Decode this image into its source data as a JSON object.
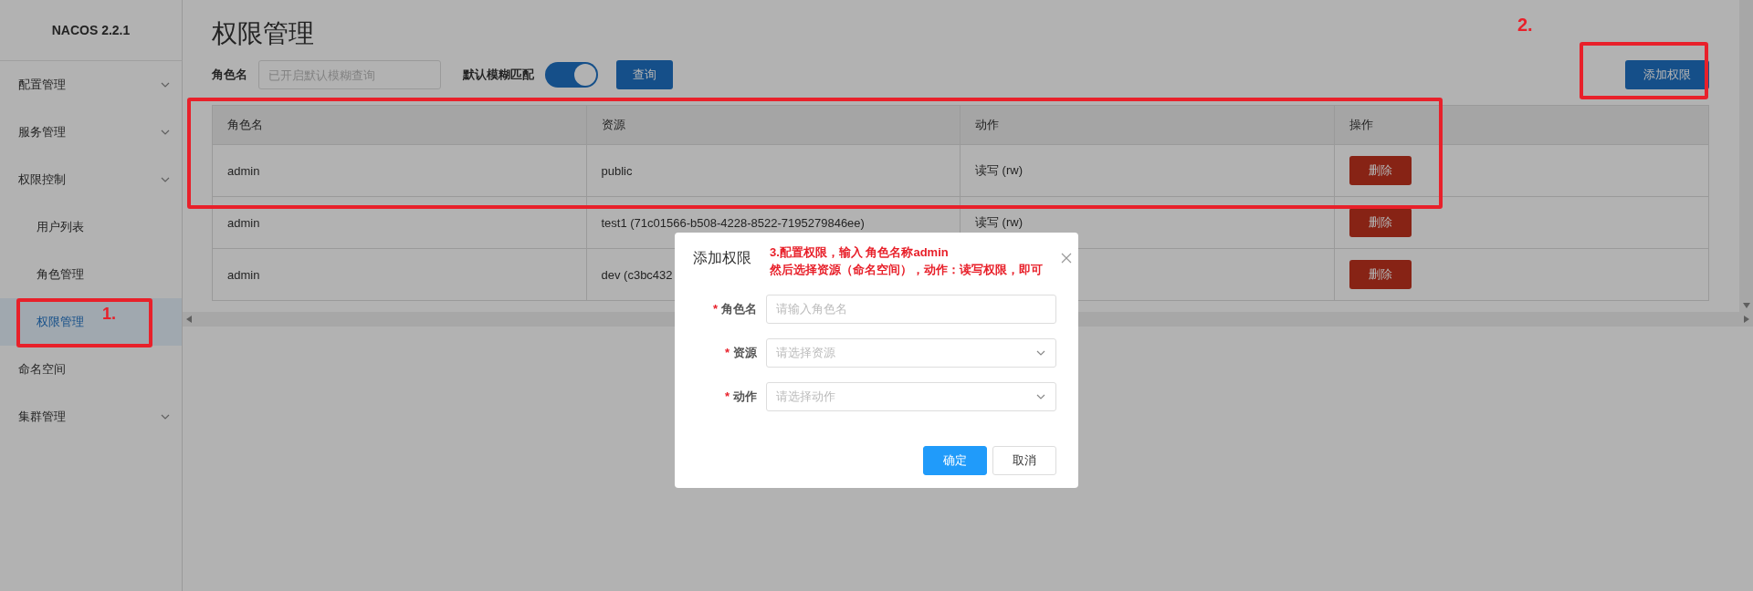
{
  "sidebar": {
    "logo": "NACOS 2.2.1",
    "items": [
      {
        "kind": "group",
        "label": "配置管理",
        "selected": false
      },
      {
        "kind": "group",
        "label": "服务管理",
        "selected": false
      },
      {
        "kind": "group",
        "label": "权限控制",
        "selected": false,
        "children": [
          {
            "label": "用户列表",
            "selected": false
          },
          {
            "label": "角色管理",
            "selected": false
          },
          {
            "label": "权限管理",
            "selected": true
          }
        ]
      },
      {
        "kind": "link",
        "label": "命名空间",
        "selected": false
      },
      {
        "kind": "group",
        "label": "集群管理",
        "selected": false
      }
    ]
  },
  "page": {
    "title": "权限管理",
    "filter": {
      "label": "角色名",
      "placeholder": "已开启默认模糊查询",
      "toggle_label": "默认模糊匹配",
      "toggle_on": true,
      "query_button": "查询"
    },
    "add_button": "添加权限",
    "table": {
      "columns": [
        "角色名",
        "资源",
        "动作",
        "操作"
      ],
      "rows": [
        {
          "cells": [
            "admin",
            "public",
            "读写 (rw)"
          ],
          "action": "删除"
        },
        {
          "cells": [
            "admin",
            "test1 (71c01566-b508-4228-8522-7195279846ee)",
            "读写 (rw)"
          ],
          "action": "删除"
        },
        {
          "cells": [
            "admin",
            "dev (c3bc432"
          ],
          "action": "删除"
        }
      ]
    }
  },
  "modal": {
    "title": "添加权限",
    "required_mark": "*",
    "fields": [
      {
        "kind": "input",
        "label": "角色名",
        "required": true,
        "placeholder": "请输入角色名"
      },
      {
        "kind": "select",
        "label": "资源",
        "required": true,
        "placeholder": "请选择资源"
      },
      {
        "kind": "select",
        "label": "动作",
        "required": true,
        "placeholder": "请选择动作"
      }
    ],
    "buttons": [
      {
        "kind": "primary",
        "label": "确定"
      },
      {
        "kind": "default",
        "label": "取消"
      }
    ]
  },
  "annotations": [
    {
      "kind": "step",
      "text": "1."
    },
    {
      "kind": "step",
      "text": "2."
    },
    {
      "kind": "note",
      "lines": [
        "3.配置权限，输入 角色名称admin",
        "然后选择资源（命名空间），动作：读写权限，即可"
      ]
    }
  ]
}
